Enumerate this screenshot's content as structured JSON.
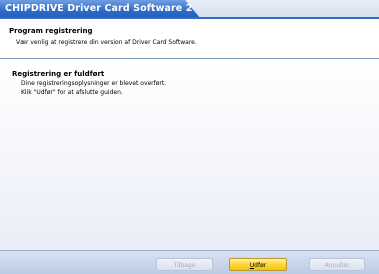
{
  "window": {
    "title": "CHIPDRIVE Driver Card Software 2"
  },
  "header": {
    "title": "Program registrering",
    "subtitle": "Vær venlig at registrere din version af Driver Card Software."
  },
  "content": {
    "section_title": "Registrering er fuldført",
    "lines": [
      "Dine registreringsoplysninger er blevet overført.",
      "Klik \"Udfør\" for at afslutte guiden."
    ]
  },
  "buttons": {
    "back": {
      "label": "Tilbage",
      "enabled": false
    },
    "finish": {
      "label_accel": "U",
      "label_rest": "dfør",
      "enabled": true
    },
    "cancel": {
      "label": "Annuller",
      "enabled": false
    }
  },
  "colors": {
    "title_bar": "#2f6ccb",
    "finish_button": "#ffd83a",
    "footer": "#c9d6ea"
  }
}
